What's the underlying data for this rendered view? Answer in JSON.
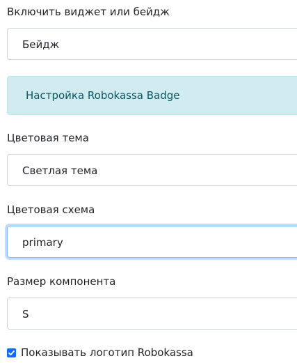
{
  "widget_or_badge": {
    "label": "Включить виджет или бейдж",
    "selected": "Бейдж"
  },
  "badge_settings_alert": {
    "text": "Настройка Robokassa Badge"
  },
  "color_theme": {
    "label": "Цветовая тема",
    "selected": "Светлая тема"
  },
  "color_scheme": {
    "label": "Цветовая схема",
    "selected": "primary"
  },
  "component_size": {
    "label": "Размер компонента",
    "selected": "S"
  },
  "show_logo": {
    "label": "Показывать логотип Robokassa",
    "checked": true
  },
  "colors": {
    "alert_background": "#d1ecf1",
    "alert_text": "#0c5460",
    "focus_border": "#86b7fe",
    "checkbox_accent": "#0d6efd"
  }
}
